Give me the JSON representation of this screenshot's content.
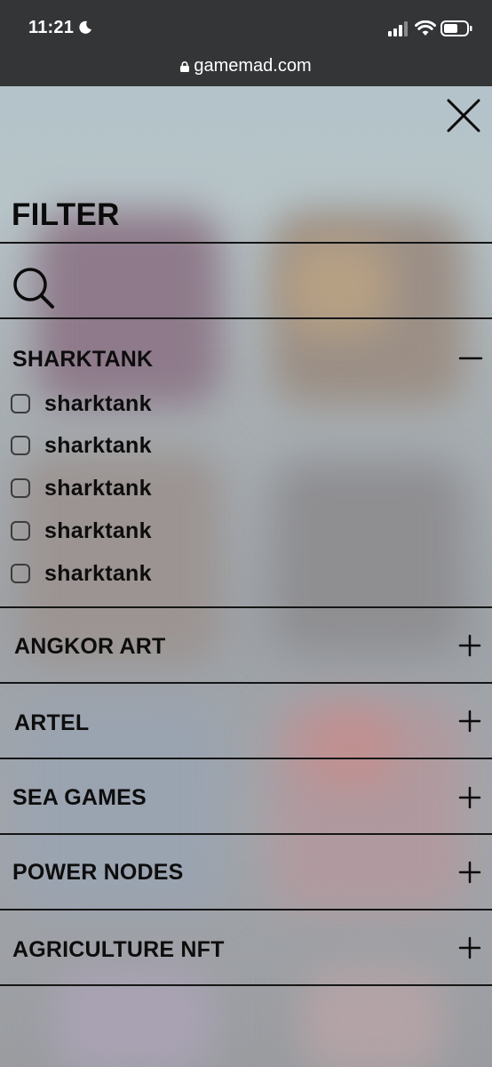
{
  "status_bar": {
    "time": "11:21",
    "url": "gamemad.com"
  },
  "filter": {
    "title": "FILTER",
    "sections": [
      {
        "label": "SHARKTANK",
        "expanded": true,
        "options": [
          "sharktank",
          "sharktank",
          "sharktank",
          "sharktank",
          "sharktank"
        ]
      },
      {
        "label": "ANGKOR ART",
        "expanded": false
      },
      {
        "label": "ARTEL",
        "expanded": false
      },
      {
        "label": "SEA GAMES",
        "expanded": false
      },
      {
        "label": "POWER NODES",
        "expanded": false
      },
      {
        "label": "AGRICULTURE NFT",
        "expanded": false
      }
    ]
  },
  "icons": {
    "close": "close-icon",
    "search": "search-icon",
    "collapse": "minus-icon",
    "expand": "plus-icon"
  },
  "colors": {
    "status_bar_bg": "#343537",
    "text": "#0d0d0d",
    "divider": "#151515"
  }
}
